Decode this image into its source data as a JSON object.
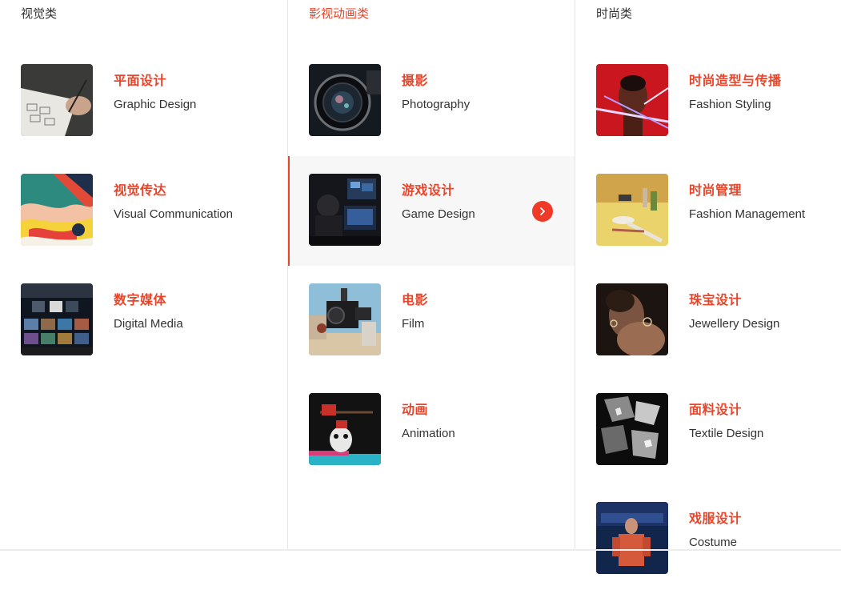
{
  "columns": [
    {
      "title": "视觉类",
      "items": [
        {
          "zh": "平面设计",
          "en": "Graphic Design"
        },
        {
          "zh": "视觉传达",
          "en": "Visual Communication"
        },
        {
          "zh": "数字媒体",
          "en": "Digital Media"
        }
      ]
    },
    {
      "title": "影视动画类",
      "items": [
        {
          "zh": "摄影",
          "en": "Photography"
        },
        {
          "zh": "游戏设计",
          "en": "Game Design"
        },
        {
          "zh": "电影",
          "en": "Film"
        },
        {
          "zh": "动画",
          "en": "Animation"
        }
      ]
    },
    {
      "title": "时尚类",
      "items": [
        {
          "zh": "时尚造型与传播",
          "en": "Fashion Styling"
        },
        {
          "zh": "时尚管理",
          "en": "Fashion Management"
        },
        {
          "zh": "珠宝设计",
          "en": "Jewellery Design"
        },
        {
          "zh": "面料设计",
          "en": "Textile Design"
        },
        {
          "zh": "戏服设计",
          "en": "Costume"
        }
      ]
    }
  ],
  "colors": {
    "accent": "#e8452a",
    "active_bg": "#f7f7f7"
  }
}
